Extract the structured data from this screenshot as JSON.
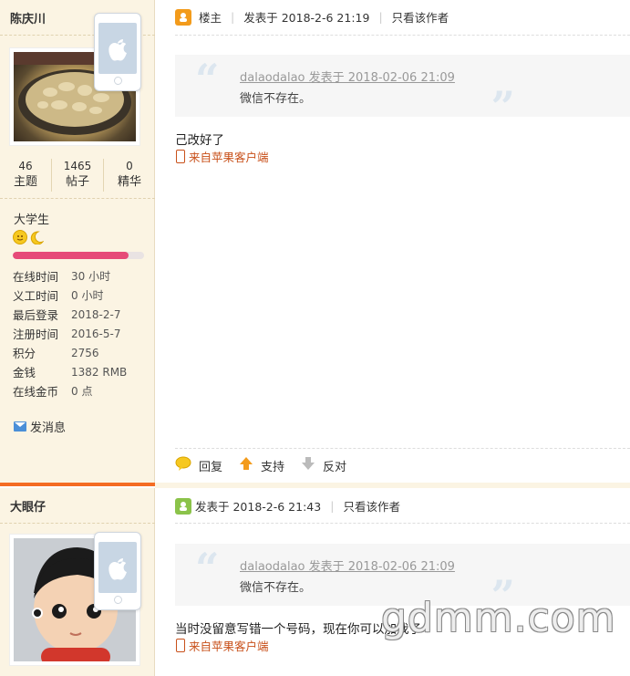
{
  "post1": {
    "user": {
      "name": "陈庆川",
      "stats": [
        {
          "num": "46",
          "label": "主题"
        },
        {
          "num": "1465",
          "label": "帖子"
        },
        {
          "num": "0",
          "label": "精华"
        }
      ],
      "rank": "大学生",
      "level_progress": 0.88,
      "info": [
        {
          "label": "在线时间",
          "value": "30 小时"
        },
        {
          "label": "义工时间",
          "value": "0 小时"
        },
        {
          "label": "最后登录",
          "value": "2018-2-7"
        },
        {
          "label": "注册时间",
          "value": "2016-5-7"
        },
        {
          "label": "积分",
          "value": "2756"
        },
        {
          "label": "金钱",
          "value": "1382 RMB"
        },
        {
          "label": "在线金币",
          "value": "0 点"
        }
      ],
      "send_message": "发消息"
    },
    "header": {
      "floor": "楼主",
      "posted": "发表于 2018-2-6 21:19",
      "only_author": "只看该作者"
    },
    "quote": {
      "author_line": "dalaodalao 发表于 2018-02-06 21:09",
      "text": "微信不存在。"
    },
    "body": "己改好了",
    "from_client": "来自苹果客户端",
    "actions": {
      "reply": "回复",
      "support": "支持",
      "oppose": "反对"
    }
  },
  "post2": {
    "user": {
      "name": "大眼仔"
    },
    "header": {
      "posted": "发表于 2018-2-6 21:43",
      "only_author": "只看该作者"
    },
    "quote": {
      "author_line": "dalaodalao 发表于 2018-02-06 21:09",
      "text": "微信不存在。"
    },
    "body": "当时没留意写错一个号码，现在你可以加我了",
    "from_client": "来自苹果客户端"
  },
  "watermark": "gdmm.com",
  "colors": {
    "accent": "#f46c24",
    "link": "#c8501a",
    "progress": "#e64a78"
  }
}
